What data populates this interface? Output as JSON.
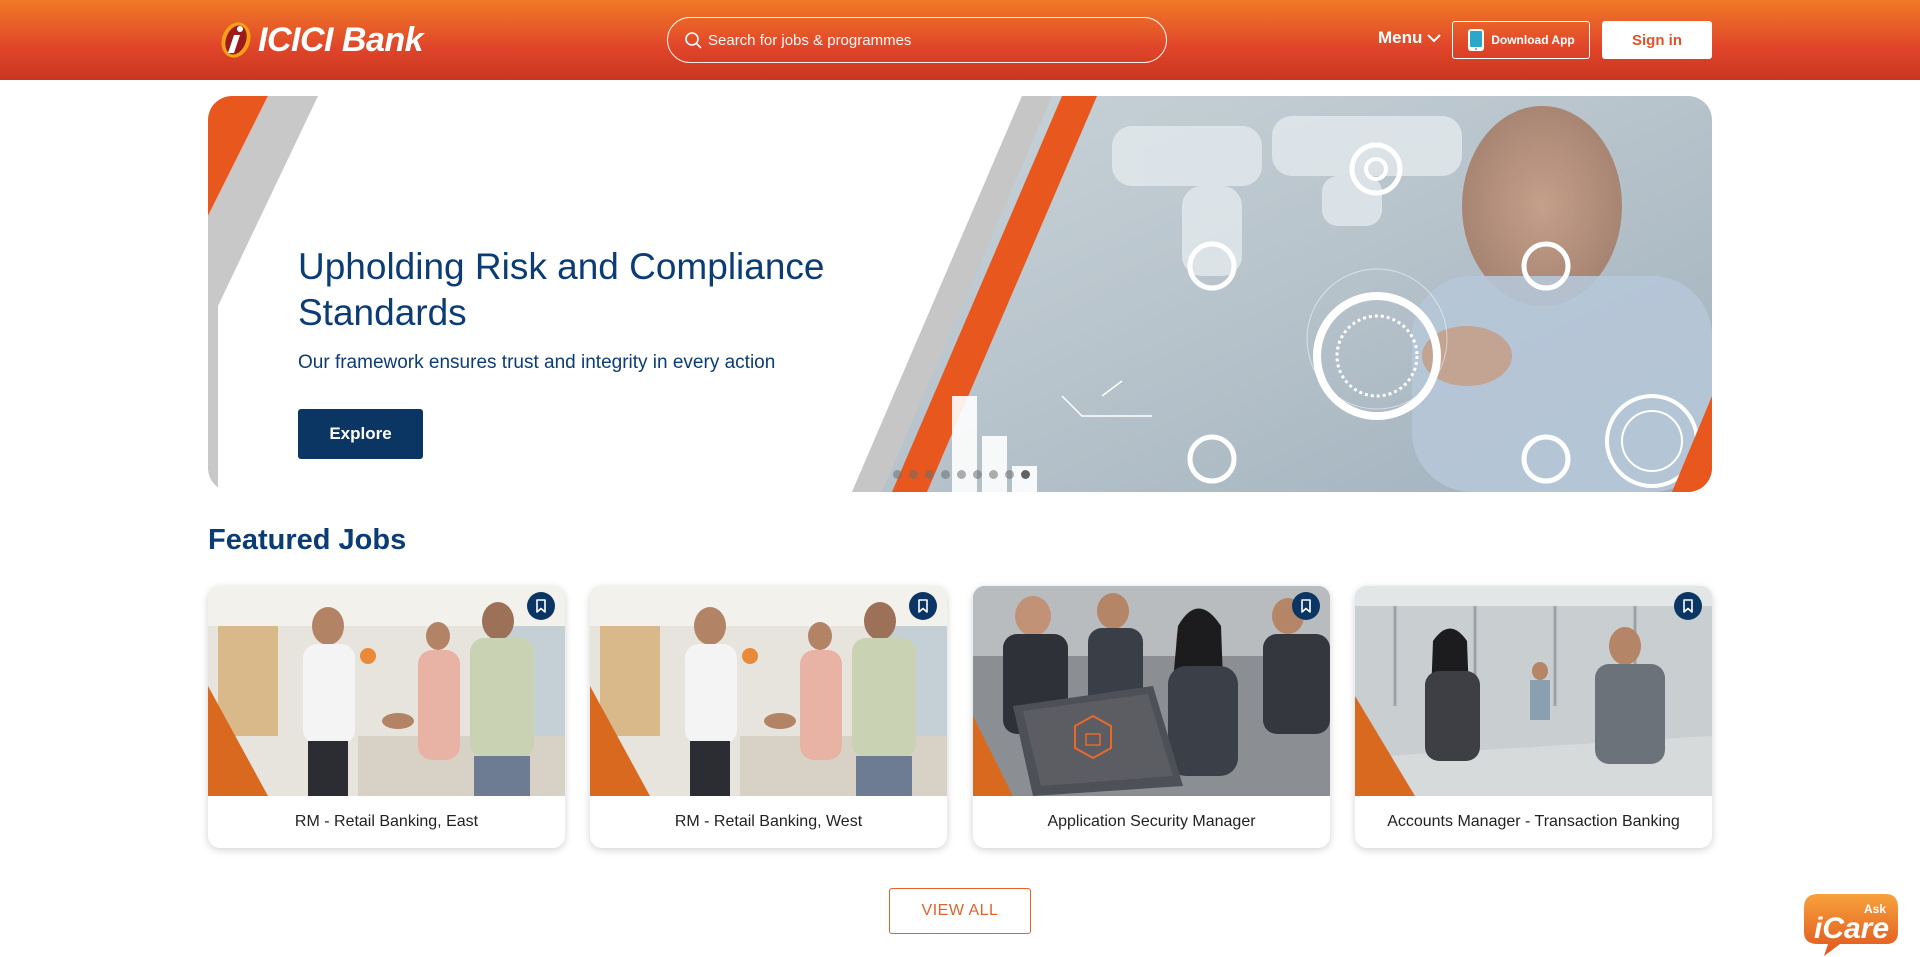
{
  "header": {
    "logo_text": "ICICI Bank",
    "search_placeholder": "Search for jobs & programmes",
    "menu_label": "Menu",
    "download_app_label": "Download App",
    "sign_in_label": "Sign in"
  },
  "hero": {
    "title": "Upholding Risk and Compliance Standards",
    "subtitle": "Our framework ensures trust and integrity in every action",
    "cta_label": "Explore",
    "slide_count": 9,
    "active_slide": 9
  },
  "featured": {
    "title": "Featured Jobs",
    "jobs": [
      {
        "title": "RM - Retail Banking, East",
        "image": "handshake-office-photo"
      },
      {
        "title": "RM - Retail Banking, West",
        "image": "handshake-office-photo"
      },
      {
        "title": "Application Security Manager",
        "image": "laptop-security-photo"
      },
      {
        "title": "Accounts Manager - Transaction Banking",
        "image": "meeting-photo"
      }
    ],
    "view_all_label": "VIEW ALL"
  },
  "chat": {
    "ask_label": "Ask",
    "brand_label": "iCare"
  },
  "colors": {
    "header_orange": "#f07a26",
    "header_red": "#c8361f",
    "navy": "#0c3c75",
    "accent_orange": "#e2632a"
  }
}
